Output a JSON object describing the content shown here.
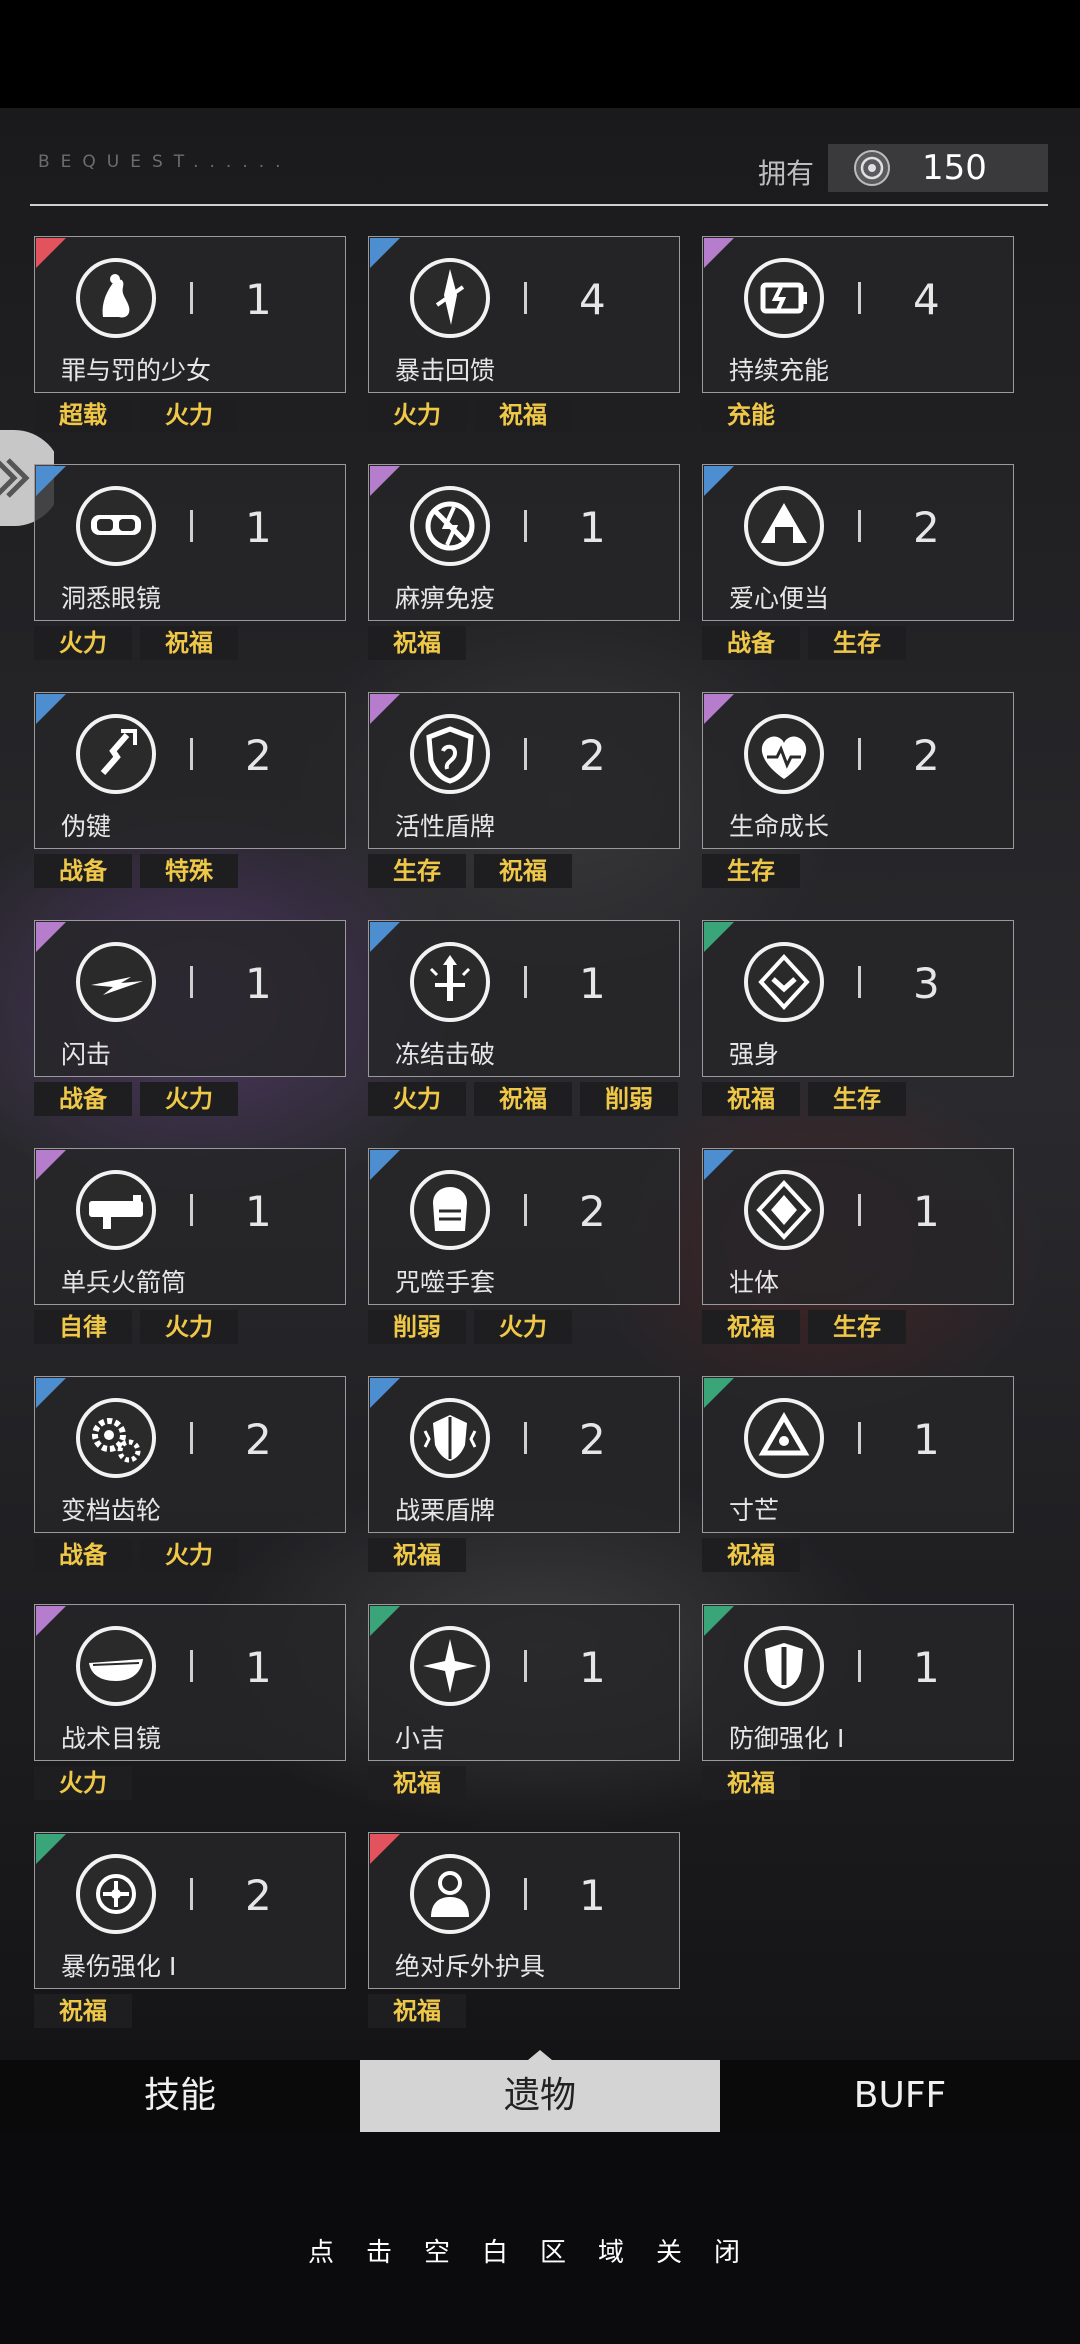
{
  "header": {
    "bequest": "BEQUEST......",
    "own_label": "拥有",
    "currency_icon": "currency-coin-icon",
    "currency_value": "150"
  },
  "relics": [
    {
      "name": "罪与罚的少女",
      "level": "1",
      "rarity": "red",
      "icon": "girl-icon",
      "tags": [
        "超载",
        "火力"
      ]
    },
    {
      "name": "暴击回馈",
      "level": "4",
      "rarity": "blue",
      "icon": "blade-icon",
      "tags": [
        "火力",
        "祝福"
      ]
    },
    {
      "name": "持续充能",
      "level": "4",
      "rarity": "purple",
      "icon": "battery-icon",
      "tags": [
        "充能"
      ]
    },
    {
      "name": "洞悉眼镜",
      "level": "1",
      "rarity": "blue",
      "icon": "goggles-icon",
      "tags": [
        "火力",
        "祝福"
      ]
    },
    {
      "name": "麻痹免疫",
      "level": "1",
      "rarity": "purple",
      "icon": "no-lightning-icon",
      "tags": [
        "祝福"
      ]
    },
    {
      "name": "爱心便当",
      "level": "2",
      "rarity": "blue",
      "icon": "rice-ball-icon",
      "tags": [
        "战备",
        "生存"
      ]
    },
    {
      "name": "伪键",
      "level": "2",
      "rarity": "blue",
      "icon": "broken-key-icon",
      "tags": [
        "战备",
        "特殊"
      ]
    },
    {
      "name": "活性盾牌",
      "level": "2",
      "rarity": "purple",
      "icon": "shield-icon",
      "tags": [
        "生存",
        "祝福"
      ]
    },
    {
      "name": "生命成长",
      "level": "2",
      "rarity": "purple",
      "icon": "heart-pulse-icon",
      "tags": [
        "生存"
      ]
    },
    {
      "name": "闪击",
      "level": "1",
      "rarity": "purple",
      "icon": "flash-icon",
      "tags": [
        "战备",
        "火力"
      ]
    },
    {
      "name": "冻结击破",
      "level": "1",
      "rarity": "blue",
      "icon": "frozen-sword-icon",
      "tags": [
        "火力",
        "祝福",
        "削弱"
      ]
    },
    {
      "name": "强身",
      "level": "3",
      "rarity": "green",
      "icon": "chevron-diamond-icon",
      "tags": [
        "祝福",
        "生存"
      ]
    },
    {
      "name": "单兵火箭筒",
      "level": "1",
      "rarity": "purple",
      "icon": "rocket-launcher-icon",
      "tags": [
        "自律",
        "火力"
      ]
    },
    {
      "name": "咒噬手套",
      "level": "2",
      "rarity": "blue",
      "icon": "gauntlet-icon",
      "tags": [
        "削弱",
        "火力"
      ]
    },
    {
      "name": "壮体",
      "level": "1",
      "rarity": "blue",
      "icon": "double-diamond-icon",
      "tags": [
        "祝福",
        "生存"
      ]
    },
    {
      "name": "变档齿轮",
      "level": "2",
      "rarity": "blue",
      "icon": "gears-icon",
      "tags": [
        "战备",
        "火力"
      ]
    },
    {
      "name": "战栗盾牌",
      "level": "2",
      "rarity": "blue",
      "icon": "shaking-shield-icon",
      "tags": [
        "祝福"
      ]
    },
    {
      "name": "寸芒",
      "level": "1",
      "rarity": "green",
      "icon": "triangle-target-icon",
      "tags": [
        "祝福"
      ]
    },
    {
      "name": "战术目镜",
      "level": "1",
      "rarity": "purple",
      "icon": "visor-icon",
      "tags": [
        "火力"
      ]
    },
    {
      "name": "小吉",
      "level": "1",
      "rarity": "green",
      "icon": "star-icon",
      "tags": [
        "祝福"
      ]
    },
    {
      "name": "防御强化 Ⅰ",
      "level": "1",
      "rarity": "green",
      "icon": "defense-shield-icon",
      "tags": [
        "祝福"
      ]
    },
    {
      "name": "暴伤强化 Ⅰ",
      "level": "2",
      "rarity": "green",
      "icon": "crosshair-icon",
      "tags": [
        "祝福"
      ]
    },
    {
      "name": "绝对斥外护具",
      "level": "1",
      "rarity": "red",
      "icon": "armor-figure-icon",
      "tags": [
        "祝福"
      ]
    }
  ],
  "tabs": {
    "skills": "技能",
    "relics": "遗物",
    "buff": "BUFF"
  },
  "close_hint": "点击空白区域关闭"
}
